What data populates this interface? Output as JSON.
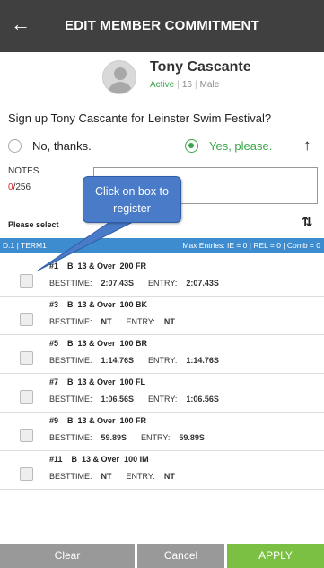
{
  "header": {
    "back_icon": "arrow-left-icon",
    "title": "EDIT MEMBER COMMITMENT"
  },
  "member": {
    "name": "Tony Cascante",
    "status": "Active",
    "age": "16",
    "gender": "Male"
  },
  "signup_prompt": "Sign up Tony Cascante for Leinster Swim Festival?",
  "options": {
    "no_label": "No, thanks.",
    "yes_label": "Yes, please.",
    "selected": "yes"
  },
  "notes": {
    "label": "NOTES",
    "used": "0",
    "limit": "/256",
    "value": ""
  },
  "select_prompt": "Please select",
  "term_bar": {
    "left": "D.1 | TERM1",
    "right": "Max Entries: IE = 0 | REL = 0 | Comb = 0"
  },
  "events": [
    {
      "num": "#1",
      "line": "B  13 & Over  200 FR",
      "best_label": "BESTTIME:",
      "best": "2:07.43S",
      "entry_label": "ENTRY:",
      "entry": "2:07.43S"
    },
    {
      "num": "#3",
      "line": "B  13 & Over  100 BK",
      "best_label": "BESTTIME:",
      "best": "NT",
      "entry_label": "ENTRY:",
      "entry": "NT"
    },
    {
      "num": "#5",
      "line": "B  13 & Over  100 BR",
      "best_label": "BESTTIME:",
      "best": "1:14.76S",
      "entry_label": "ENTRY:",
      "entry": "1:14.76S"
    },
    {
      "num": "#7",
      "line": "B  13 & Over  100 FL",
      "best_label": "BESTTIME:",
      "best": "1:06.56S",
      "entry_label": "ENTRY:",
      "entry": "1:06.56S"
    },
    {
      "num": "#9",
      "line": "B  13 & Over  100 FR",
      "best_label": "BESTTIME:",
      "best": "59.89S",
      "entry_label": "ENTRY:",
      "entry": "59.89S"
    },
    {
      "num": "#11",
      "line": "B  13 & Over  100 IM",
      "best_label": "BESTTIME:",
      "best": "NT",
      "entry_label": "ENTRY:",
      "entry": "NT"
    }
  ],
  "footer": {
    "clear": "Clear",
    "cancel": "Cancel",
    "apply": "APPLY"
  },
  "callout": {
    "line1": "Click on box to",
    "line2": "register"
  },
  "colors": {
    "topbar": "#404040",
    "accent_green": "#3aa54a",
    "term_blue": "#3c8ccf",
    "apply_green": "#7bc043",
    "callout_blue": "#4a7bc8"
  }
}
